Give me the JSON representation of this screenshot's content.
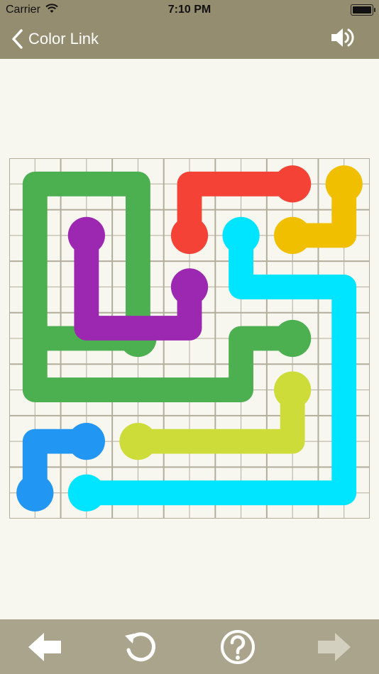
{
  "status_bar": {
    "carrier": "Carrier",
    "time": "7:10 PM"
  },
  "nav": {
    "back_label": "Color Link"
  },
  "board": {
    "grid_cols": 7,
    "grid_rows": 7,
    "grid_color": "#b3ae9c",
    "flows": [
      {
        "color": "green",
        "hex": "#4caf50",
        "cells": [
          [
            0.5,
            3.5
          ],
          [
            2.5,
            3.5
          ],
          [
            2.5,
            0
          ],
          [
            0,
            0
          ],
          [
            0,
            4.5
          ],
          [
            4.5,
            4.5
          ],
          [
            4.5,
            3.5
          ],
          [
            5.5,
            3.5
          ]
        ],
        "endpoints": [
          [
            2.5,
            3.5
          ],
          [
            5.5,
            3.5
          ]
        ]
      },
      {
        "color": "red",
        "hex": "#f44336",
        "cells": [
          [
            3.5,
            1.5
          ],
          [
            3.5,
            0.5
          ],
          [
            5.5,
            0.5
          ]
        ],
        "endpoints": [
          [
            3.5,
            1.5
          ],
          [
            5.5,
            0.5
          ]
        ]
      },
      {
        "color": "yellow",
        "hex": "#f0c000",
        "cells": [
          [
            6.5,
            0.5
          ],
          [
            6.5,
            1.5
          ],
          [
            5.5,
            1.5
          ]
        ],
        "endpoints": [
          [
            6.5,
            0.5
          ],
          [
            5.5,
            1.5
          ]
        ]
      },
      {
        "color": "purple",
        "hex": "#9c27b0",
        "cells": [
          [
            1.5,
            1.5
          ],
          [
            1.5,
            3.3
          ],
          [
            3.5,
            3.3
          ],
          [
            3.5,
            2.5
          ]
        ],
        "endpoints": [
          [
            1.5,
            1.5
          ],
          [
            3.5,
            2.5
          ]
        ]
      },
      {
        "color": "cyan",
        "hex": "#00e5ff",
        "cells": [
          [
            4.5,
            1.5
          ],
          [
            4.5,
            2.5
          ],
          [
            6.5,
            2.5
          ],
          [
            6.5,
            6.5
          ],
          [
            1.5,
            6.5
          ]
        ],
        "endpoints": [
          [
            4.5,
            1.5
          ],
          [
            1.5,
            6.5
          ]
        ]
      },
      {
        "color": "lime",
        "hex": "#cddc39",
        "cells": [
          [
            5.5,
            4.5
          ],
          [
            5.5,
            5.5
          ],
          [
            2.5,
            5.5
          ]
        ],
        "endpoints": [
          [
            5.5,
            4.5
          ],
          [
            2.5,
            5.5
          ]
        ]
      },
      {
        "color": "blue",
        "hex": "#2196f3",
        "cells": [
          [
            1.5,
            5.5
          ],
          [
            0.5,
            5.5
          ],
          [
            0.5,
            6.5
          ]
        ],
        "endpoints": [
          [
            1.5,
            5.5
          ],
          [
            0.5,
            6.5
          ]
        ]
      }
    ]
  },
  "toolbar": {
    "back_icon": "arrow-left-icon",
    "restart_icon": "restart-icon",
    "help_icon": "help-icon",
    "next_icon": "arrow-right-icon"
  },
  "colors": {
    "header": "#958d6f",
    "footer": "#aaa48c",
    "background": "#f7f6ef"
  }
}
